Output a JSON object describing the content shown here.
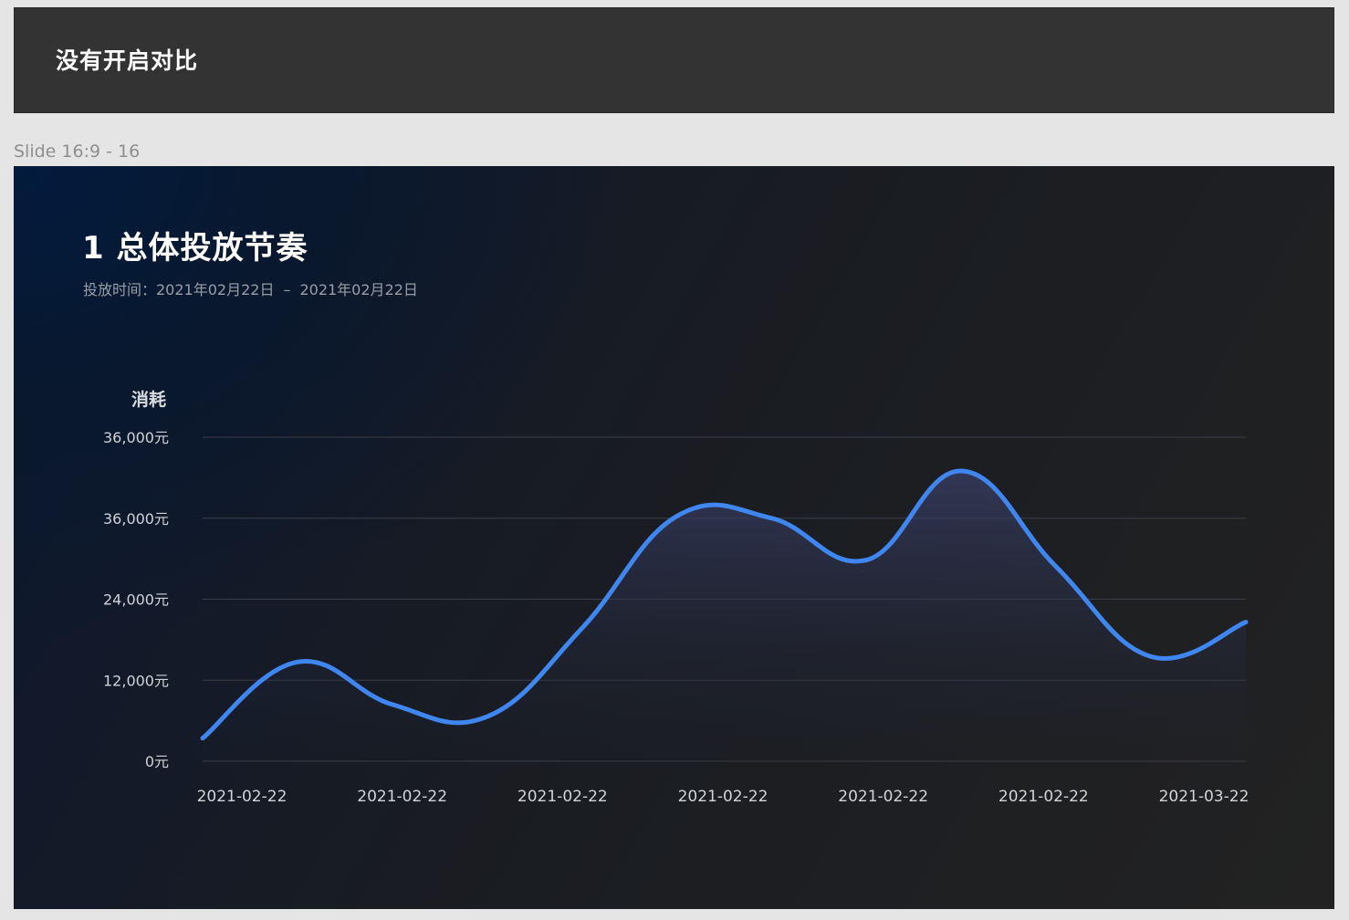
{
  "header": {
    "title": "没有开启对比"
  },
  "frame_label": "Slide 16:9 - 16",
  "slide": {
    "title": "1 总体投放节奏",
    "subtitle_prefix": "投放时间：2021年02月22日",
    "subtitle_sep": "–",
    "subtitle_end": "2021年02月22日"
  },
  "colors": {
    "line": "#3f86f0",
    "area_top": "#3a3f66",
    "grid": "#3a3e47"
  },
  "chart_data": {
    "type": "area",
    "title": "",
    "ylabel": "消耗",
    "xlabel": "",
    "ylim": [
      0,
      48000
    ],
    "y_ticks": [
      0,
      12000,
      24000,
      36000,
      48000
    ],
    "y_tick_labels": [
      "0元",
      "12,000元",
      "24,000元",
      "36,000元",
      "36,000元"
    ],
    "x_tick_labels": [
      "2021-02-22",
      "2021-02-22",
      "2021-02-22",
      "2021-02-22",
      "2021-02-22",
      "2021-02-22",
      "2021-03-22"
    ],
    "grid": true,
    "smooth": true,
    "series": [
      {
        "values": [
          3400,
          14700,
          8400,
          6600,
          19700,
          36300,
          36000,
          29800,
          43000,
          28800,
          15500,
          20600
        ]
      }
    ]
  }
}
